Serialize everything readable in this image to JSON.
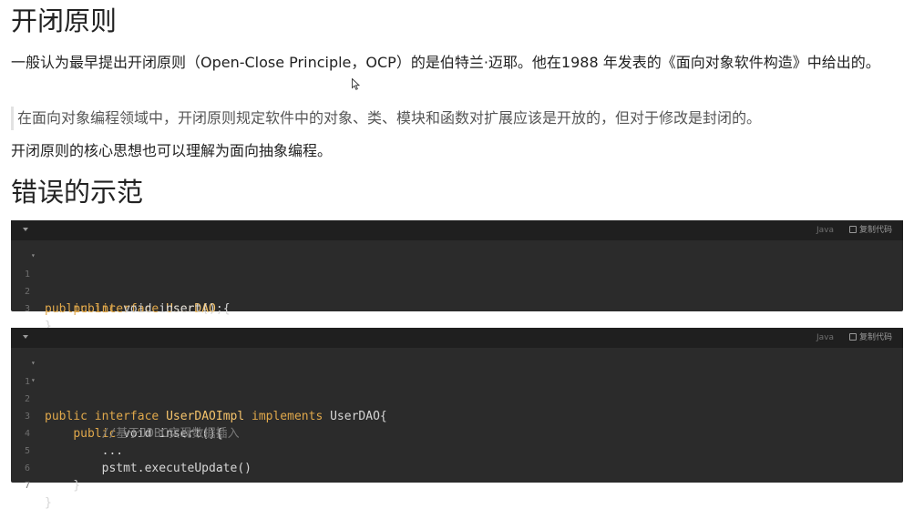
{
  "section1": {
    "title": "开闭原则",
    "para1": "一般认为最早提出开闭原则（Open-Close Principle，OCP）的是伯特兰·迈耶。他在1988 年发表的《面向对象软件构造》中给出的。",
    "quote": "在面向对象编程领域中，开闭原则规定软件中的对象、类、模块和函数对扩展应该是开放的，但对于修改是封闭的。",
    "para2": "开闭原则的核心思想也可以理解为面向抽象编程。"
  },
  "section2": {
    "title": "错误的示范"
  },
  "code_blocks": [
    {
      "lang": "Java",
      "copy_label": "复制代码",
      "lines": [
        {
          "n": "1",
          "parts": [
            "public",
            " ",
            "interface",
            " ",
            "UserDAO",
            " {"
          ]
        },
        {
          "n": "2",
          "parts": [
            "    ",
            "public",
            " void insert();"
          ]
        },
        {
          "n": "3",
          "parts": [
            "}"
          ]
        }
      ]
    },
    {
      "lang": "Java",
      "copy_label": "复制代码",
      "lines": [
        {
          "n": "1",
          "parts": [
            "public",
            " ",
            "interface",
            " ",
            "UserDAOImpl",
            " ",
            "implements",
            " UserDAO{"
          ]
        },
        {
          "n": "2",
          "parts": [
            "    ",
            "public",
            " void insert(){"
          ]
        },
        {
          "n": "3",
          "parts": [
            "        ",
            "//基于JDBC实现数据插入"
          ]
        },
        {
          "n": "4",
          "parts": [
            "        ..."
          ]
        },
        {
          "n": "5",
          "parts": [
            "        pstmt.executeUpdate()"
          ]
        },
        {
          "n": "6",
          "parts": [
            "    }"
          ]
        },
        {
          "n": "7",
          "parts": [
            "}"
          ]
        }
      ]
    }
  ]
}
